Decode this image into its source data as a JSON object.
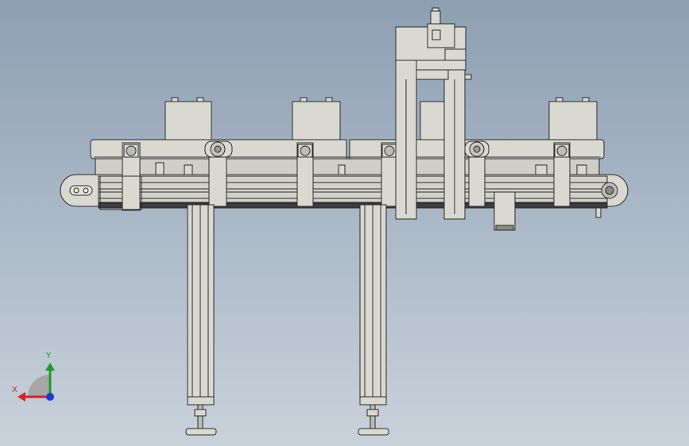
{
  "viewport": {
    "background_top": "#8d9fb2",
    "background_bottom": "#c9d2db",
    "model_fill": "#d9d9d2",
    "model_edge": "#2a2a2a"
  },
  "triad": {
    "x_label": "X",
    "y_label": "Y",
    "x_color": "#d8202a",
    "y_color": "#1b9a2e",
    "z_color": "#1d39d6"
  }
}
